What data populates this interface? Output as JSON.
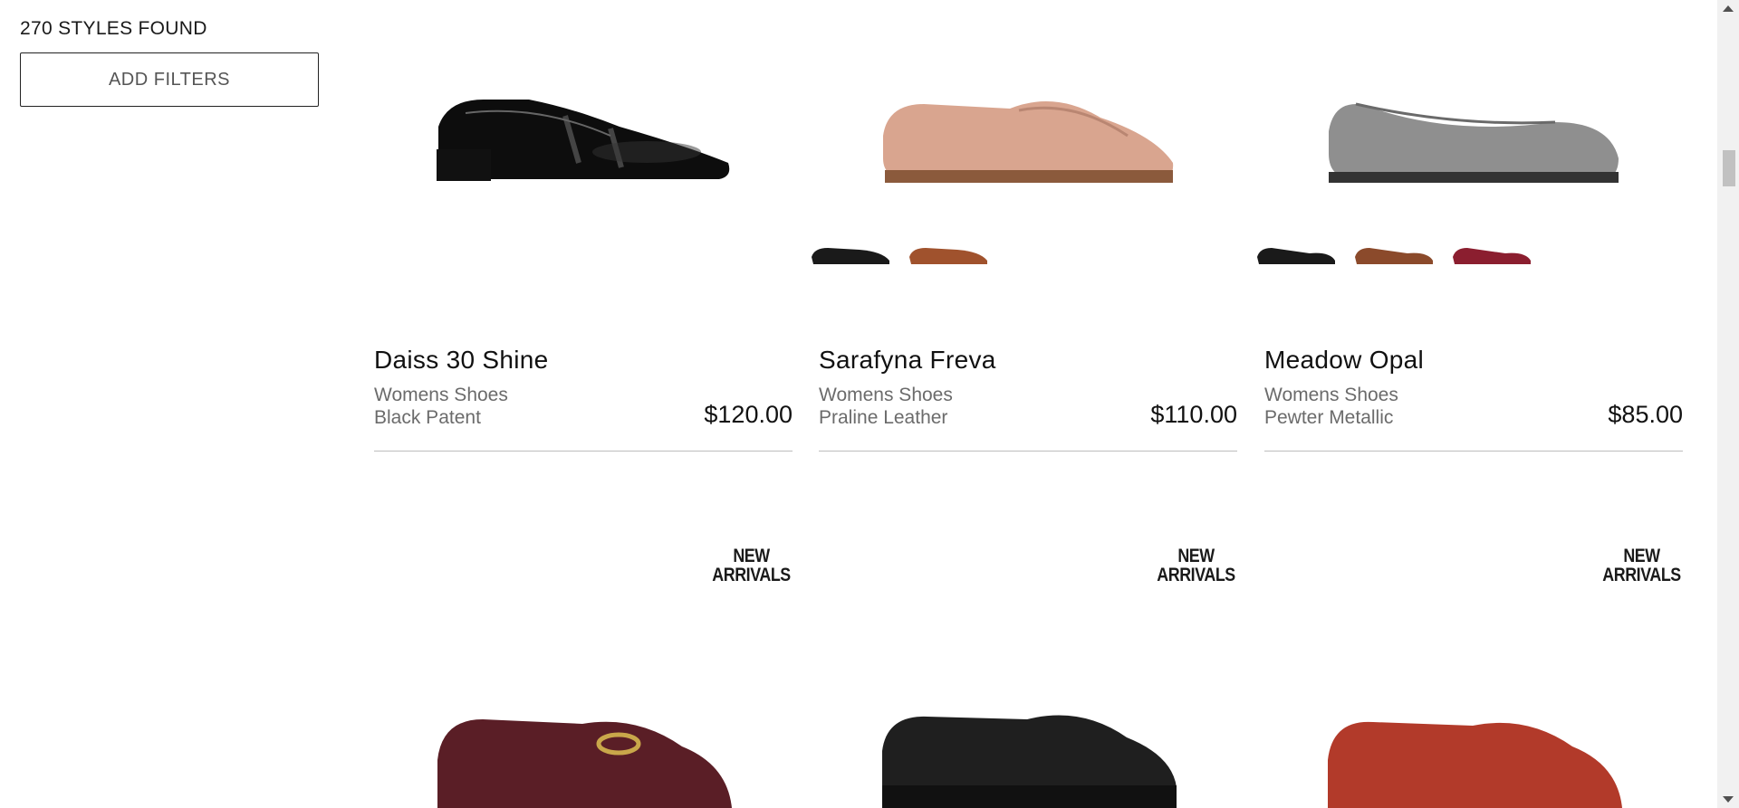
{
  "results": {
    "count_label": "270 STYLES FOUND",
    "filter_button": "ADD FILTERS"
  },
  "products": [
    {
      "name": "Daiss 30 Shine",
      "category": "Womens Shoes",
      "color": "Black Patent",
      "price": "$120.00"
    },
    {
      "name": "Sarafyna Freva",
      "category": "Womens Shoes",
      "color": "Praline Leather",
      "price": "$110.00"
    },
    {
      "name": "Meadow Opal",
      "category": "Womens Shoes",
      "color": "Pewter Metallic",
      "price": "$85.00"
    }
  ],
  "badges": {
    "new_arrivals_line1": "NEW",
    "new_arrivals_line2": "ARRIVALS"
  },
  "colors": {
    "black_patent": "#111111",
    "praline": "#d9a58f",
    "pewter": "#8f8f8f",
    "burgundy": "#5a1e26",
    "black_leather": "#1f1f1f",
    "rust": "#b23a2a",
    "tan": "#a0522d"
  }
}
